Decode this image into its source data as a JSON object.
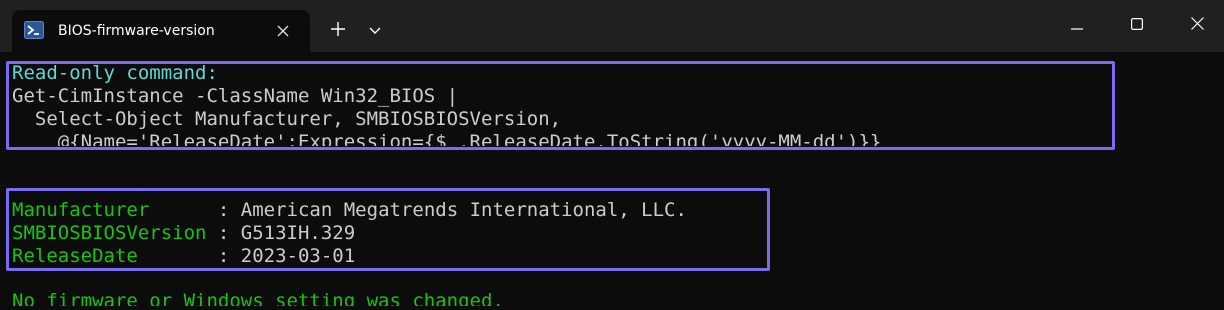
{
  "tab": {
    "title": "BIOS-firmware-version",
    "icon": "powershell-icon"
  },
  "colors": {
    "accent_box": "#7a6cf0",
    "comment": "#61d6d6",
    "key": "#16c60c",
    "text": "#cccccc",
    "background": "#0c0c0c",
    "titlebar": "#202020"
  },
  "command_block": {
    "label": "Read-only command:",
    "lines": [
      "Get-CimInstance -ClassName Win32_BIOS |",
      "  Select-Object Manufacturer, SMBIOSBIOSVersion,",
      "    @{Name='ReleaseDate';Expression={$_.ReleaseDate.ToString('yyyy-MM-dd')}}"
    ]
  },
  "output_block": {
    "rows": [
      {
        "key": "Manufacturer     ",
        "sep": " : ",
        "value": "American Megatrends International, LLC."
      },
      {
        "key": "SMBIOSBIOSVersion",
        "sep": " : ",
        "value": "G513IH.329"
      },
      {
        "key": "ReleaseDate      ",
        "sep": " : ",
        "value": "2023-03-01"
      }
    ]
  },
  "footer": {
    "message": "No firmware or Windows setting was changed."
  }
}
